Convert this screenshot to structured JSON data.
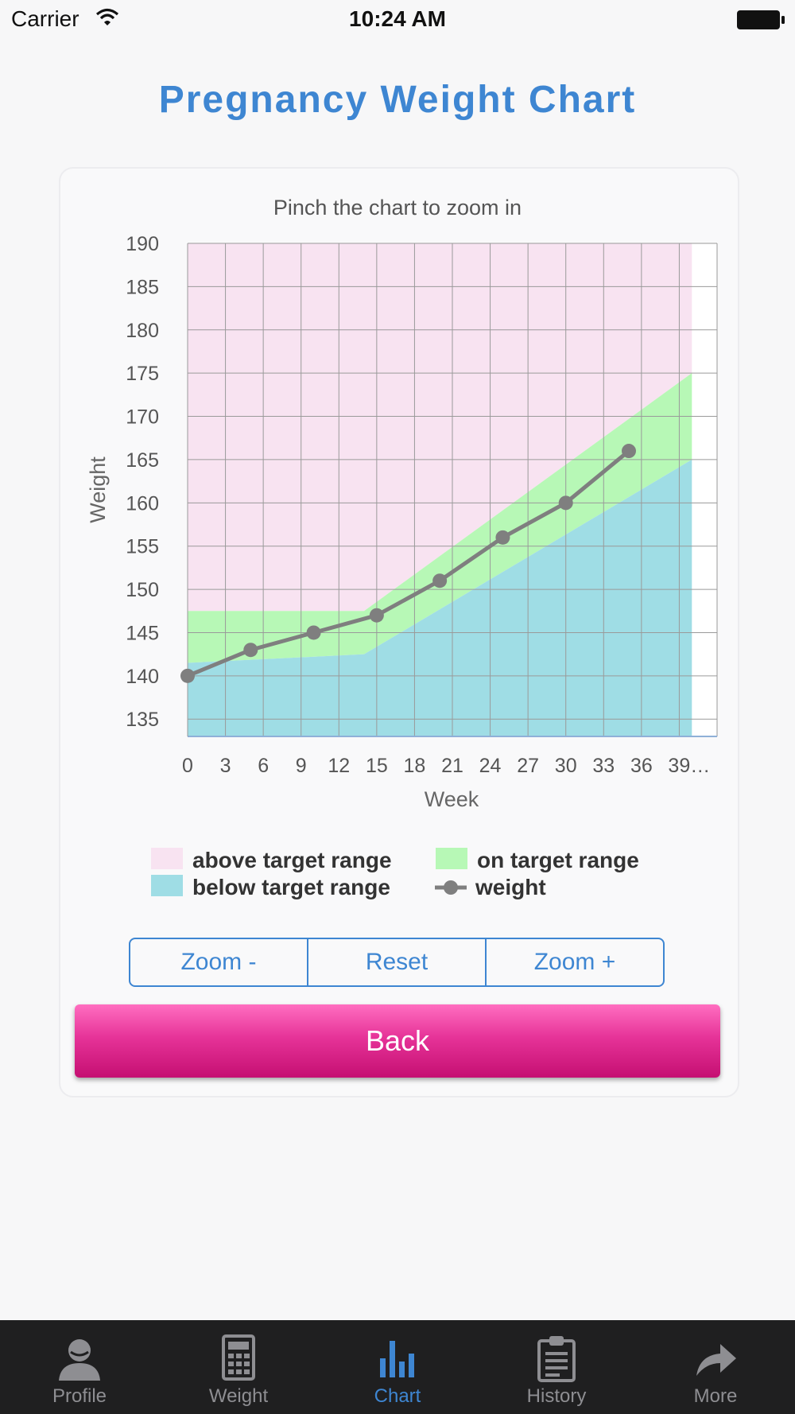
{
  "status_bar": {
    "carrier": "Carrier",
    "time": "10:24 AM"
  },
  "page": {
    "title": "Pregnancy Weight Chart"
  },
  "chart": {
    "hint": "Pinch the chart to zoom in",
    "legend": {
      "above": "above target range",
      "on": "on target range",
      "below": "below target range",
      "weight": "weight"
    }
  },
  "chart_data": {
    "type": "line",
    "xlabel": "Week",
    "ylabel": "Weight",
    "xlim": [
      0,
      42
    ],
    "ylim": [
      133,
      190
    ],
    "x_ticks": [
      "0",
      "3",
      "6",
      "9",
      "12",
      "15",
      "18",
      "21",
      "24",
      "27",
      "30",
      "33",
      "36",
      "39…"
    ],
    "y_ticks": [
      190,
      185,
      180,
      175,
      170,
      165,
      160,
      155,
      150,
      145,
      140,
      135
    ],
    "grid": true,
    "legend_position": "bottom",
    "colors": {
      "above": "#f8e3f1",
      "on": "#b7f8b6",
      "below": "#9fdde5",
      "weight": "#7f7f7f"
    },
    "series": [
      {
        "name": "weight",
        "x": [
          0,
          5,
          10,
          15,
          20,
          25,
          30,
          35
        ],
        "y": [
          140,
          143,
          145,
          147,
          151,
          156,
          160,
          166
        ]
      }
    ],
    "bands": {
      "x": [
        0,
        14,
        40
      ],
      "upper": [
        147.5,
        147.5,
        175
      ],
      "lower": [
        141.5,
        142.5,
        165
      ],
      "top": 190
    }
  },
  "controls": {
    "zoom_minus": "Zoom -",
    "reset": "Reset",
    "zoom_plus": "Zoom +",
    "back": "Back"
  },
  "tab_bar": {
    "items": [
      {
        "label": "Profile",
        "icon": "profile-icon"
      },
      {
        "label": "Weight",
        "icon": "calculator-icon"
      },
      {
        "label": "Chart",
        "icon": "bar-chart-icon",
        "active": true
      },
      {
        "label": "History",
        "icon": "clipboard-icon"
      },
      {
        "label": "More",
        "icon": "share-arrow-icon"
      }
    ],
    "active_color": "#3e86d2",
    "inactive_color": "#8e8e92"
  }
}
